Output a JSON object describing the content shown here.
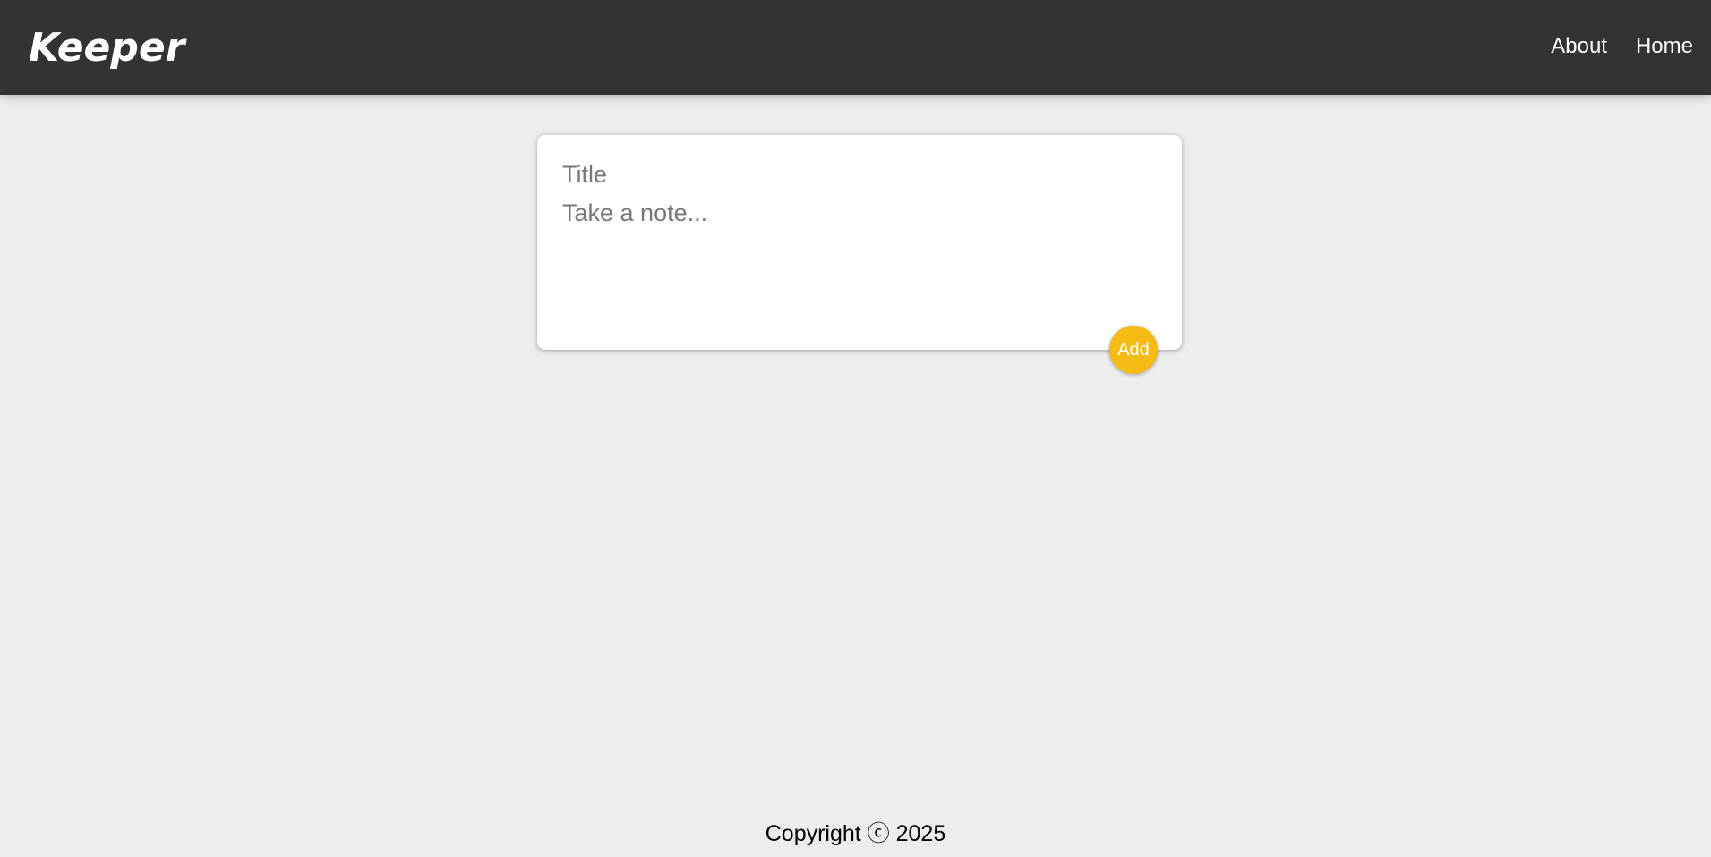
{
  "header": {
    "logo": "Keeper",
    "nav": [
      {
        "label": "About"
      },
      {
        "label": "Home"
      }
    ]
  },
  "note_form": {
    "title_placeholder": "Title",
    "title_value": "",
    "content_placeholder": "Take a note...",
    "content_value": "",
    "add_label": "Add"
  },
  "footer": {
    "copyright": "Copyright ⓒ 2025"
  },
  "colors": {
    "header_bg": "#333333",
    "page_bg": "#ededed",
    "accent": "#f5ba13"
  }
}
